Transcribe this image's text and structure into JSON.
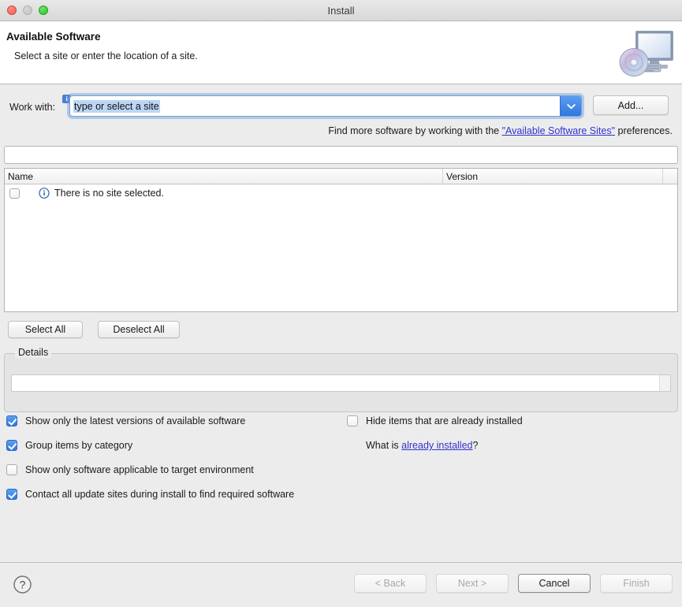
{
  "window": {
    "title": "Install",
    "controls": {
      "close": "close",
      "minimize": "minimize",
      "zoom": "zoom"
    }
  },
  "header": {
    "title": "Available Software",
    "subtitle": "Select a site or enter the location of a site.",
    "icon": "install-monitor-disc-icon"
  },
  "work_with": {
    "label": "Work with:",
    "info_badge": "i",
    "combo_value": "type or select a site",
    "combo_placeholder": "type or select a site",
    "dropdown_icon": "chevron-down-icon",
    "add_button": "Add..."
  },
  "find_more": {
    "prefix": "Find more software by working with the ",
    "link": "\"Available Software Sites\"",
    "suffix": " preferences."
  },
  "filter": {
    "value": "",
    "placeholder": ""
  },
  "table": {
    "columns": [
      "Name",
      "Version",
      ""
    ],
    "rows": [
      {
        "checked": false,
        "icon": "info-circle-icon",
        "name": "There is no site selected.",
        "version": ""
      }
    ]
  },
  "selection_buttons": {
    "select_all": "Select All",
    "deselect_all": "Deselect All"
  },
  "details": {
    "group_label": "Details",
    "content": ""
  },
  "options": {
    "left": [
      {
        "label": "Show only the latest versions of available software",
        "checked": true
      },
      {
        "label": "Group items by category",
        "checked": true
      },
      {
        "label": "Show only software applicable to target environment",
        "checked": false
      },
      {
        "label": "Contact all update sites during install to find required software",
        "checked": true
      }
    ],
    "right": [
      {
        "label": "Hide items that are already installed",
        "checked": false
      }
    ],
    "what_is": {
      "prefix": "What is ",
      "link": "already installed",
      "suffix": "?"
    }
  },
  "footer": {
    "help_icon": "help-question-icon",
    "buttons": [
      {
        "label": "< Back",
        "enabled": false,
        "default": false
      },
      {
        "label": "Next >",
        "enabled": false,
        "default": false
      },
      {
        "label": "Cancel",
        "enabled": true,
        "default": true
      },
      {
        "label": "Finish",
        "enabled": false,
        "default": false
      }
    ]
  },
  "colors": {
    "accent_blue": "#3179dd",
    "link_blue": "#3333cc",
    "window_bg": "#ececec",
    "header_bg": "#ffffff"
  }
}
